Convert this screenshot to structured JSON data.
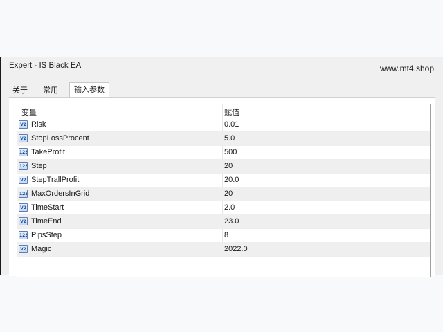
{
  "window": {
    "title": "Expert - IS Black EA",
    "site": "www.mt4.shop"
  },
  "tabs": [
    {
      "label": "关于",
      "active": false
    },
    {
      "label": "常用",
      "active": false
    },
    {
      "label": "输入参数",
      "active": true
    }
  ],
  "grid": {
    "headers": {
      "variable": "变量",
      "value": "赋值"
    },
    "rows": [
      {
        "icon": "double-value-icon",
        "icon_text": "V2",
        "name": "Risk",
        "value": "0.01"
      },
      {
        "icon": "double-value-icon",
        "icon_text": "V2",
        "name": "StopLossProcent",
        "value": "5.0"
      },
      {
        "icon": "integer-value-icon",
        "icon_text": "123",
        "name": "TakeProfit",
        "value": "500"
      },
      {
        "icon": "integer-value-icon",
        "icon_text": "123",
        "name": "Step",
        "value": "20"
      },
      {
        "icon": "double-value-icon",
        "icon_text": "V2",
        "name": "StepTrallProfit",
        "value": "20.0"
      },
      {
        "icon": "integer-value-icon",
        "icon_text": "123",
        "name": "MaxOrdersInGrid",
        "value": "20"
      },
      {
        "icon": "double-value-icon",
        "icon_text": "V2",
        "name": "TimeStart",
        "value": "2.0"
      },
      {
        "icon": "double-value-icon",
        "icon_text": "V2",
        "name": "TimeEnd",
        "value": "23.0"
      },
      {
        "icon": "integer-value-icon",
        "icon_text": "123",
        "name": "PipsStep",
        "value": "8"
      },
      {
        "icon": "double-value-icon",
        "icon_text": "V2",
        "name": "Magic",
        "value": "2022.0"
      }
    ]
  },
  "colors": {
    "window_bg": "#f0f0f0",
    "grid_alt_row": "#efefef",
    "icon_border": "#5a7fb5"
  }
}
